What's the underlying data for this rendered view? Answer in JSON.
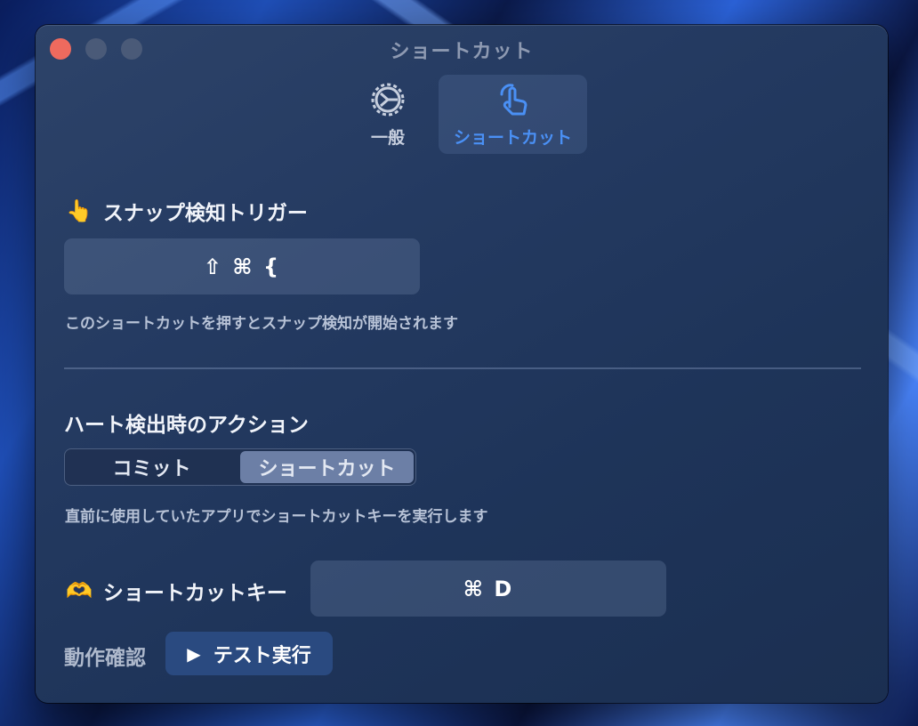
{
  "window": {
    "title": "ショートカット"
  },
  "toolbar": {
    "tabs": [
      {
        "label": "一般",
        "icon": "gear-icon",
        "selected": false
      },
      {
        "label": "ショートカット",
        "icon": "hand-tap-icon",
        "selected": true
      }
    ],
    "accent_color": "#4a90f5"
  },
  "snap_trigger": {
    "emoji": "👆",
    "heading": "スナップ検知トリガー",
    "shortcut": "⇧ ⌘ {",
    "description": "このショートカットを押すとスナップ検知が開始されます"
  },
  "heart_action": {
    "heading": "ハート検出時のアクション",
    "options": [
      "コミット",
      "ショートカット"
    ],
    "selected": "ショートカット",
    "description": "直前に使用していたアプリでショートカットキーを実行します"
  },
  "shortcut_key": {
    "emoji": "🫶",
    "label": "ショートカットキー",
    "value": "⌘ D"
  },
  "verify": {
    "label": "動作確認",
    "button_icon": "▶",
    "button_label": "テスト実行"
  }
}
